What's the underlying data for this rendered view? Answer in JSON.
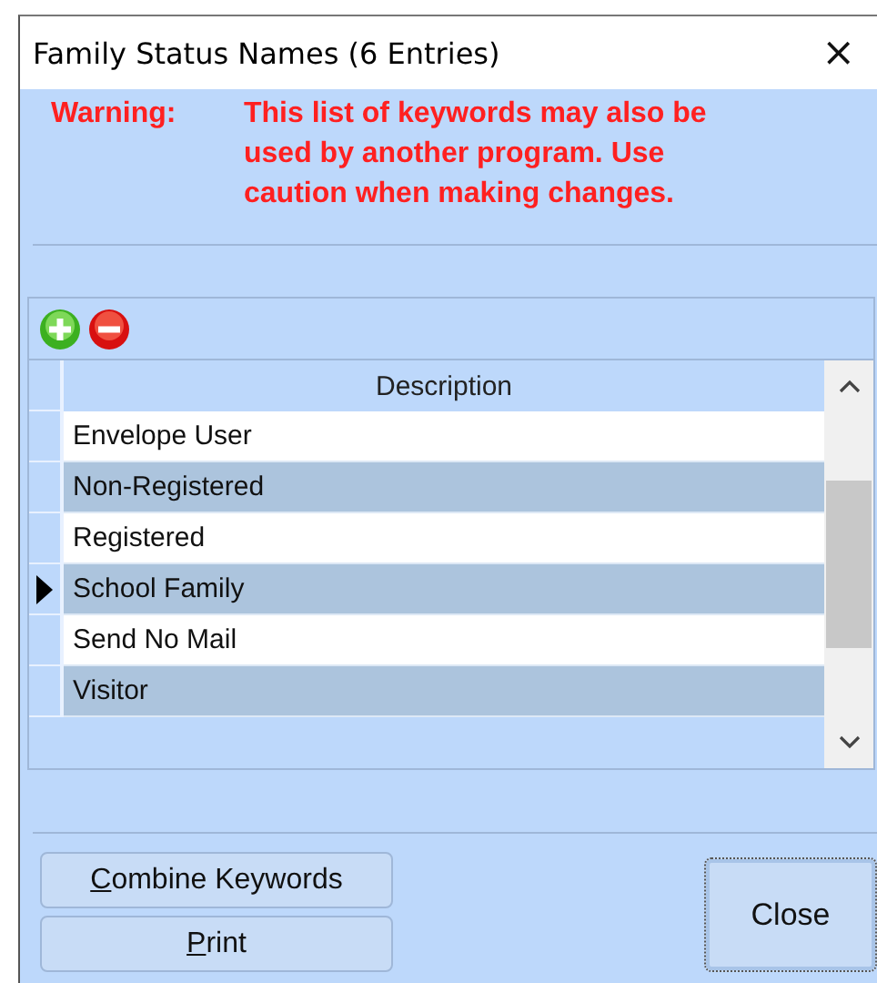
{
  "window": {
    "title": "Family Status Names (6 Entries)",
    "close_glyph": "×"
  },
  "warning": {
    "label": "Warning:",
    "message": "This list of keywords may also be used by another program. Use caution when making changes."
  },
  "table": {
    "columns": [
      "Description"
    ],
    "rows": [
      {
        "description": "Envelope User",
        "selected": false
      },
      {
        "description": "Non-Registered",
        "selected": false
      },
      {
        "description": "Registered",
        "selected": false
      },
      {
        "description": "School Family",
        "selected": true
      },
      {
        "description": "Send No Mail",
        "selected": false
      },
      {
        "description": "Visitor",
        "selected": false
      }
    ]
  },
  "buttons": [
    {
      "label": "Combine Keywords",
      "kind": "small"
    },
    {
      "label": "Print",
      "kind": "small"
    },
    {
      "label": "Close",
      "kind": "default"
    }
  ]
}
